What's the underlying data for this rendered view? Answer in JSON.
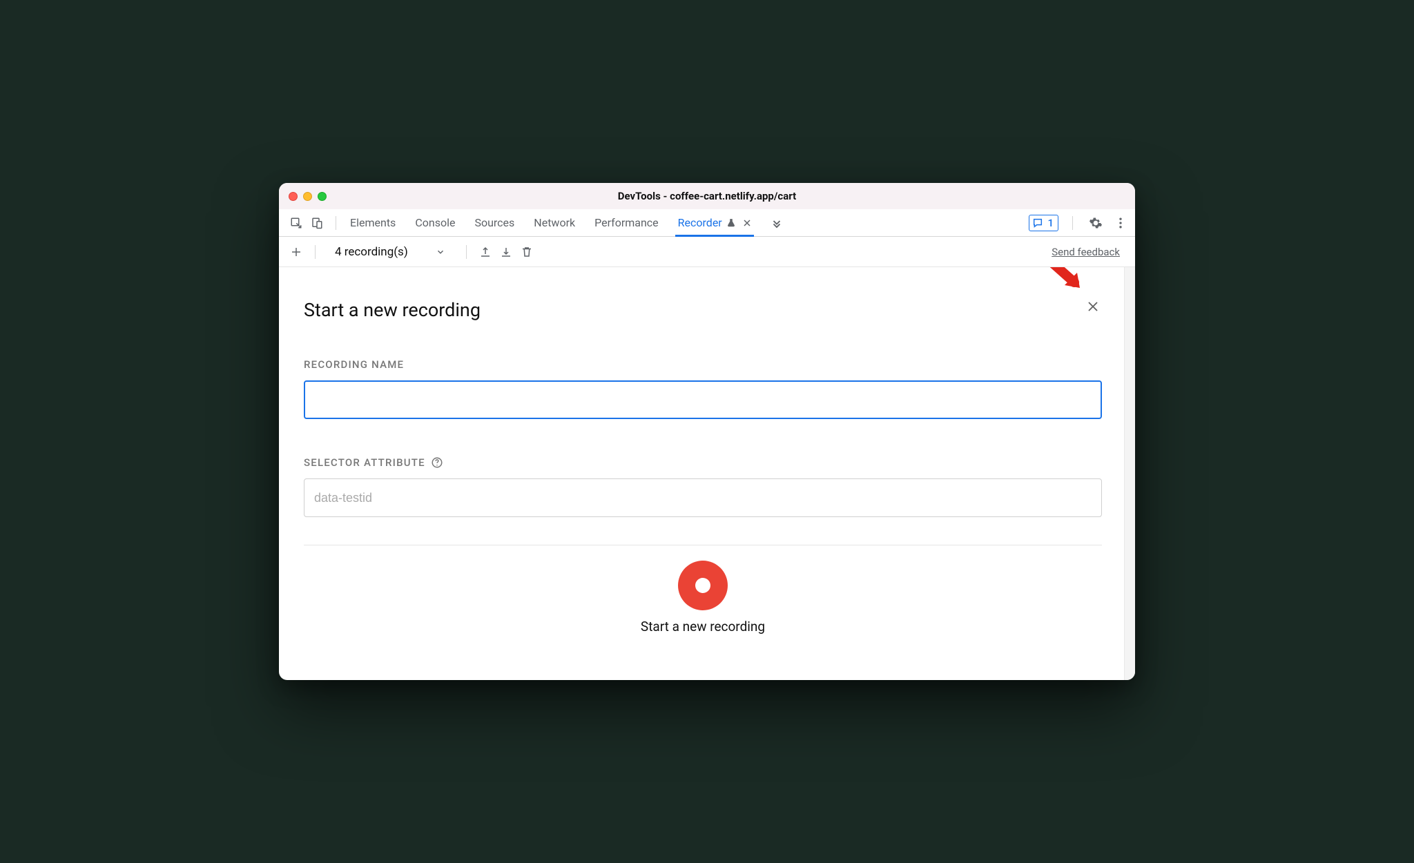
{
  "window": {
    "title": "DevTools - coffee-cart.netlify.app/cart"
  },
  "tabs": {
    "items": [
      {
        "label": "Elements",
        "active": false
      },
      {
        "label": "Console",
        "active": false
      },
      {
        "label": "Sources",
        "active": false
      },
      {
        "label": "Network",
        "active": false
      },
      {
        "label": "Performance",
        "active": false
      },
      {
        "label": "Recorder",
        "active": true
      }
    ],
    "issues_count": "1"
  },
  "toolbar": {
    "dropdown_label": "4 recording(s)",
    "feedback_label": "Send feedback"
  },
  "panel": {
    "title": "Start a new recording",
    "recording_name_label": "RECORDING NAME",
    "recording_name_value": "",
    "selector_attr_label": "SELECTOR ATTRIBUTE",
    "selector_attr_placeholder": "data-testid",
    "selector_attr_value": "",
    "start_button_label": "Start a new recording"
  }
}
